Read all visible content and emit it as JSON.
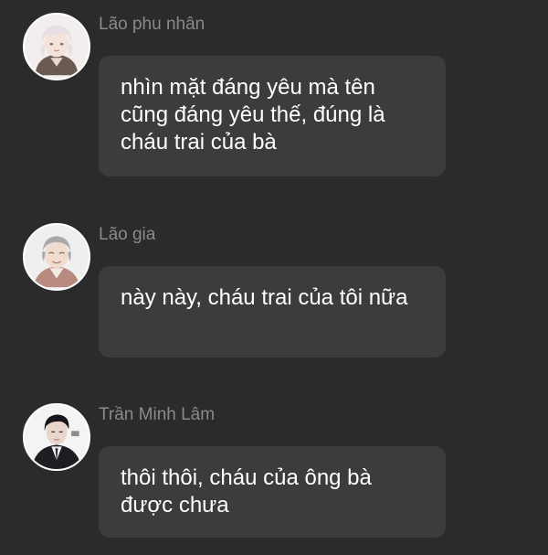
{
  "messages": [
    {
      "sender": "Lão phu nhân",
      "avatar_icon": "elderly-woman-avatar-icon",
      "text": "nhìn mặt đáng yêu mà tên cũng đáng yêu thế, đúng là cháu trai của bà"
    },
    {
      "sender": "Lão gia",
      "avatar_icon": "elderly-man-avatar-icon",
      "text": "này này, cháu trai của tôi nữa"
    },
    {
      "sender": "Trần Minh Lâm",
      "avatar_icon": "man-in-suit-avatar-icon",
      "text": "thôi thôi, cháu của ông bà được chưa"
    }
  ],
  "colors": {
    "background": "#2b2b2b",
    "bubble": "#3c3c3c",
    "sender_name": "#8a8a8a",
    "message_text": "#ffffff"
  }
}
